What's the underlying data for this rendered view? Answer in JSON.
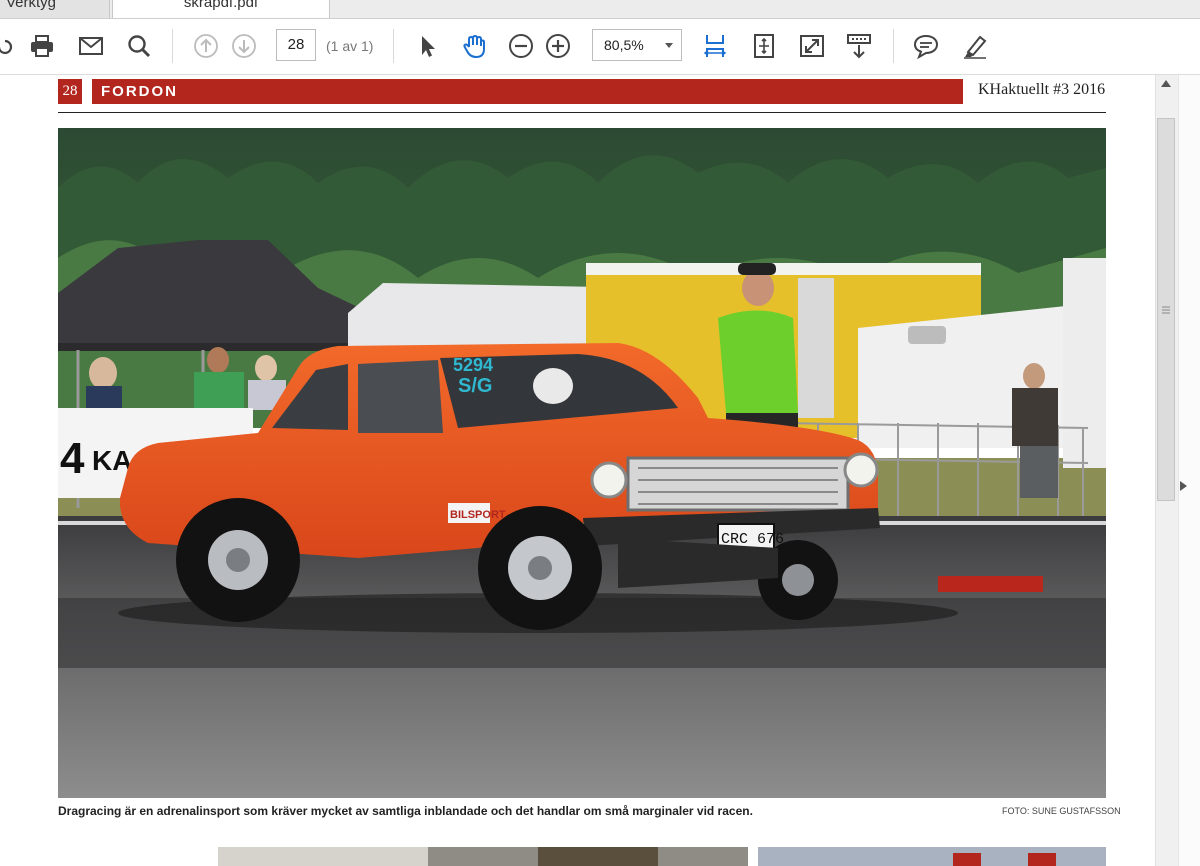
{
  "tabs": {
    "tools_label": "Verktyg",
    "document_label": "skrapdf.pdf"
  },
  "toolbar": {
    "page_number": "28",
    "page_count": "(1 av 1)",
    "zoom_value": "80,5%"
  },
  "page": {
    "page_num": "28",
    "section": "FORDON",
    "magazine": "KHaktuellt #3 2016",
    "photo_plate": "CRC 676",
    "photo_sign": "BILSPORT",
    "photo_number": "5294",
    "photo_class": "S/G",
    "caption": "Dragracing är en adrenalinsport som kräver mycket av samtliga inblandade och det handlar om små marginaler vid racen.",
    "credit": "FOTO: SUNE GUSTAFSSON"
  },
  "colors": {
    "section_red": "#b2261e",
    "icon_blue": "#1a6fd1",
    "icon_gray": "#444444",
    "car_orange": "#e8541e"
  }
}
